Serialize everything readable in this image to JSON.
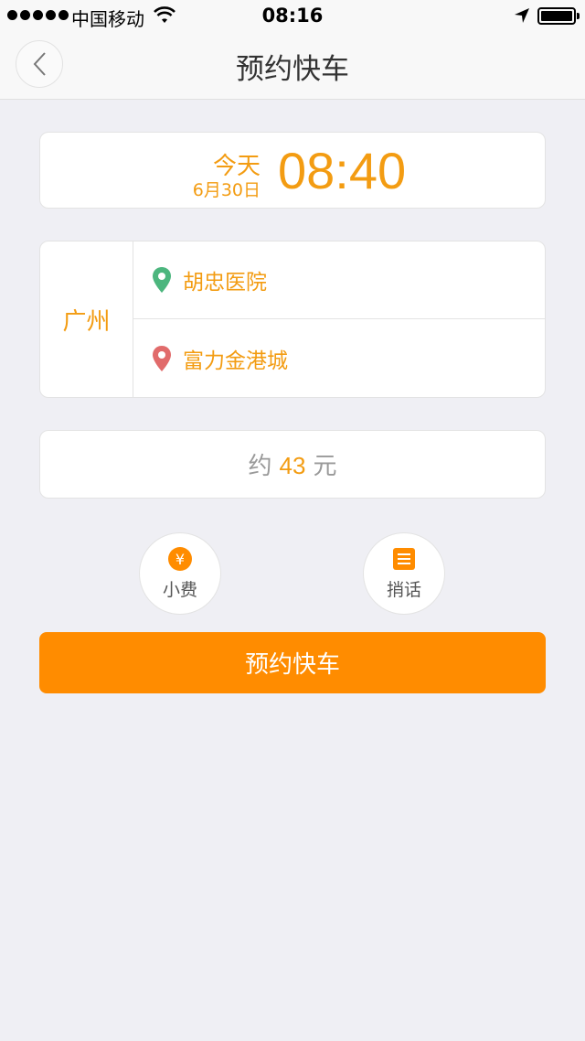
{
  "status_bar": {
    "carrier": "中国移动",
    "time": "08:16"
  },
  "nav": {
    "title": "预约快车",
    "back_icon": "chevron-left-icon"
  },
  "schedule": {
    "day": "今天",
    "date": "6月30日",
    "time": "08:40"
  },
  "route": {
    "city": "广州",
    "from": "胡忠医院",
    "to": "富力金港城"
  },
  "price": {
    "prefix": "约",
    "amount": "43",
    "unit": "元"
  },
  "options": [
    {
      "label": "小费",
      "icon": "yen-coin-icon"
    },
    {
      "label": "捎话",
      "icon": "note-icon"
    }
  ],
  "action": {
    "label": "预约快车"
  },
  "colors": {
    "accent": "#f39c12",
    "button": "#ff8c00",
    "start_pin": "#4cb67e",
    "end_pin": "#e16b6b"
  }
}
